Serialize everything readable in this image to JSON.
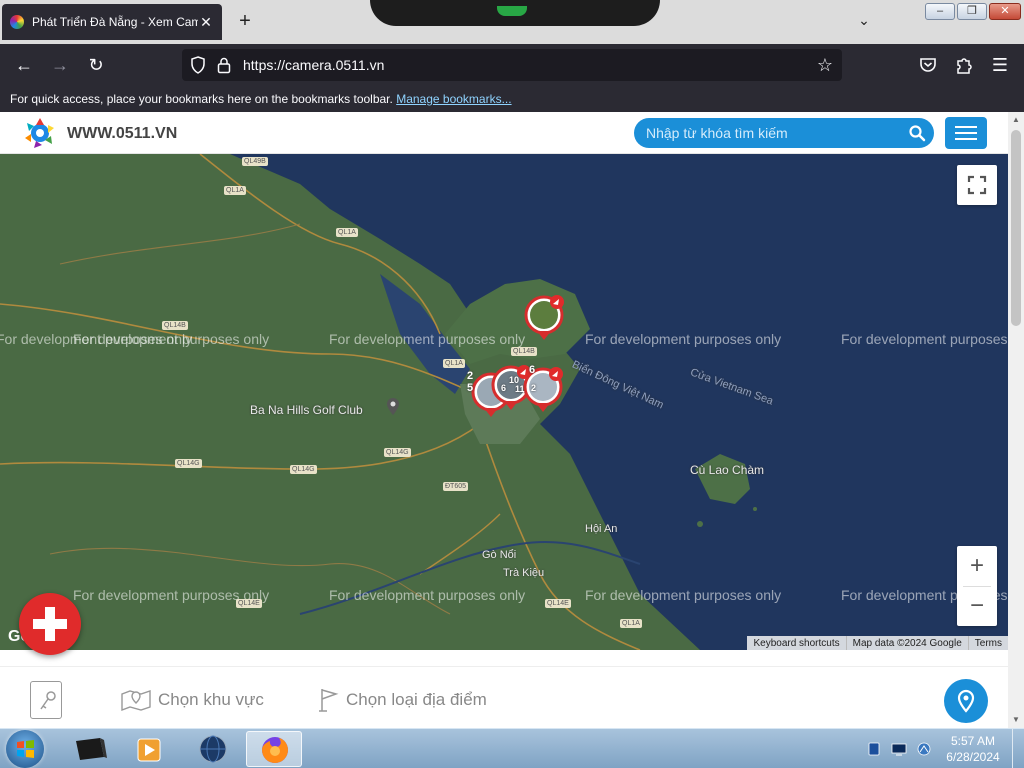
{
  "browser": {
    "tab_title": "Phát Triển Đà Nẵng - Xem Camera",
    "url": "https://camera.0511.vn",
    "bookmarks_message": "For quick access, place your bookmarks here on the bookmarks toolbar.",
    "bookmarks_link": "Manage bookmarks..."
  },
  "site": {
    "name": "WWW.0511.VN",
    "search_placeholder": "Nhập từ khóa tìm kiếm"
  },
  "map": {
    "watermark": "For development purposes only",
    "places": [
      {
        "id": "bana",
        "label": "Ba Na Hills Golf Club"
      },
      {
        "id": "culao",
        "label": "Cù Lao Chàm"
      },
      {
        "id": "hoian",
        "label": "Hội An"
      },
      {
        "id": "gonoi",
        "label": "Gò Nổi"
      },
      {
        "id": "trakieu",
        "label": "Trà Kiệu"
      }
    ],
    "sea_labels": [
      "Biển Đông Việt Nam",
      "Cửa Vietnam Sea"
    ],
    "roads": [
      "QL49B",
      "QL1A",
      "QL1A",
      "QL14B",
      "QL1A",
      "QL14G",
      "QL14G",
      "QL14G",
      "QL14B",
      "ĐT605",
      "QL14E",
      "QL14E",
      "QL1A"
    ],
    "cluster_counts": [
      "2",
      "5",
      "6",
      "10",
      "11",
      "6",
      "2"
    ],
    "google": "Google",
    "attribution": [
      "Keyboard shortcuts",
      "Map data ©2024 Google",
      "Terms"
    ]
  },
  "bottom": {
    "region": "Chọn khu vực",
    "type": "Chọn loại địa điểm"
  },
  "taskbar": {
    "time": "5:57 AM",
    "date": "6/28/2024"
  },
  "colors": {
    "accent": "#1b8fd8",
    "danger": "#e02b2b",
    "sea": "#20365e",
    "land": "#4a6a44"
  }
}
